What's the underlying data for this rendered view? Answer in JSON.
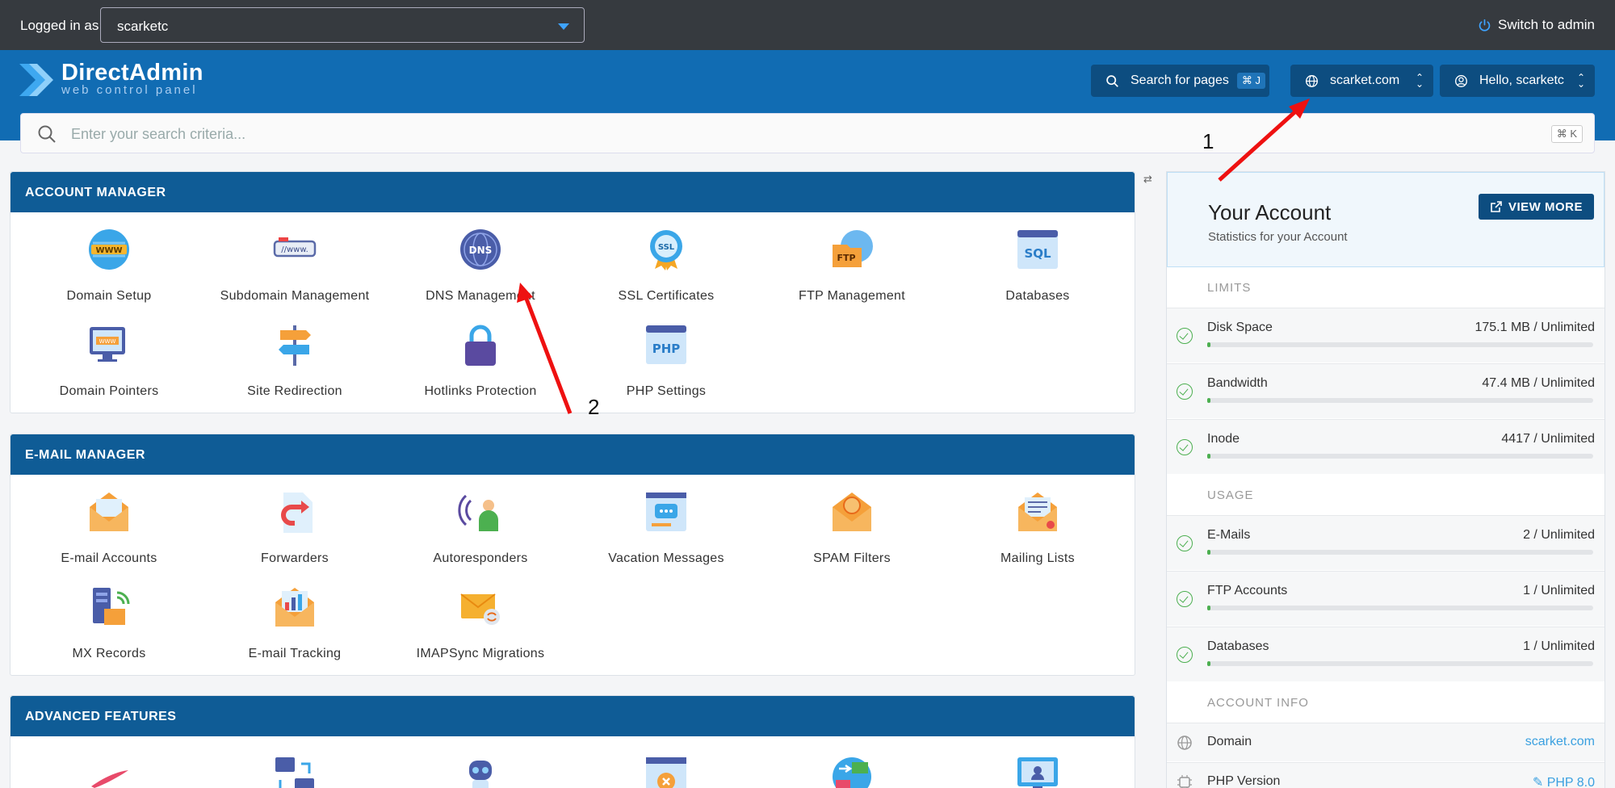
{
  "topbar": {
    "logged_in_label": "Logged in as",
    "user_value": "scarketc",
    "switch_admin": "Switch to admin"
  },
  "brand": {
    "name": "DirectAdmin",
    "tagline": "web control panel"
  },
  "header": {
    "search_pages": "Search for pages",
    "search_kbd": "⌘ J",
    "domain": "scarket.com",
    "hello": "Hello, scarketc"
  },
  "search": {
    "placeholder": "Enter your search criteria...",
    "kbd": "⌘ K"
  },
  "sections": {
    "account": {
      "title": "ACCOUNT MANAGER",
      "items": [
        "Domain Setup",
        "Subdomain Management",
        "DNS Management",
        "SSL Certificates",
        "FTP Management",
        "Databases",
        "Domain Pointers",
        "Site Redirection",
        "Hotlinks Protection",
        "PHP Settings"
      ]
    },
    "email": {
      "title": "E-MAIL MANAGER",
      "items": [
        "E-mail Accounts",
        "Forwarders",
        "Autoresponders",
        "Vacation Messages",
        "SPAM Filters",
        "Mailing Lists",
        "MX Records",
        "E-mail Tracking",
        "IMAPSync Migrations"
      ]
    },
    "advanced": {
      "title": "ADVANCED FEATURES"
    }
  },
  "sidebar": {
    "title": "Your Account",
    "subtitle": "Statistics for your Account",
    "view_more": "VIEW MORE",
    "limits_label": "LIMITS",
    "usage_label": "USAGE",
    "info_label": "ACCOUNT INFO",
    "limits": [
      {
        "name": "Disk Space",
        "value": "175.1 MB / Unlimited"
      },
      {
        "name": "Bandwidth",
        "value": "47.4 MB / Unlimited"
      },
      {
        "name": "Inode",
        "value": "4417 / Unlimited"
      }
    ],
    "usage": [
      {
        "name": "E-Mails",
        "value": "2 / Unlimited"
      },
      {
        "name": "FTP Accounts",
        "value": "1 / Unlimited"
      },
      {
        "name": "Databases",
        "value": "1 / Unlimited"
      }
    ],
    "info": [
      {
        "name": "Domain",
        "value": "scarket.com"
      },
      {
        "name": "PHP Version",
        "value": "PHP 8.0"
      }
    ]
  },
  "annotations": {
    "one": "1",
    "two": "2"
  },
  "colors": {
    "header": "#116cb3",
    "topbar": "#363a3f",
    "section_head": "#0f5c96",
    "arrow": "#ee1111",
    "ok": "#4caf50"
  }
}
